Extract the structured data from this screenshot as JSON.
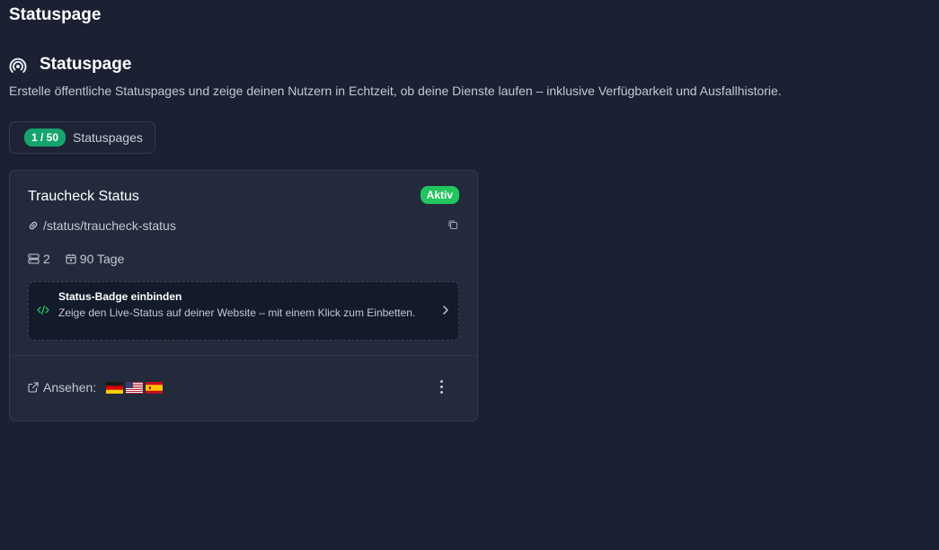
{
  "app": {
    "title": "Statuspage"
  },
  "section": {
    "title": "Statuspage",
    "icon": "broadcast-icon",
    "description": "Erstelle öffentliche Statuspages und zeige deinen Nutzern in Echtzeit, ob deine Dienste laufen – inklusive Verfügbarkeit und Ausfallhistorie."
  },
  "quota": {
    "count": "1 / 50",
    "label": "Statuspages"
  },
  "card": {
    "title": "Traucheck Status",
    "status": "Aktiv",
    "url": "/status/traucheck-status",
    "monitors": "2",
    "retention": "90 Tage",
    "badge": {
      "title": "Status-Badge einbinden",
      "description": "Zeige den Live-Status auf deiner Website – mit einem Klick zum Einbetten."
    },
    "view_label": "Ansehen:",
    "flags": [
      "de-flag-icon",
      "us-flag-icon",
      "es-flag-icon"
    ]
  },
  "colors": {
    "background": "#1b2033",
    "card": "#222a3c",
    "accent_green": "#22c55e",
    "count_green": "#16a46e",
    "badge_icon": "#22c55e"
  }
}
